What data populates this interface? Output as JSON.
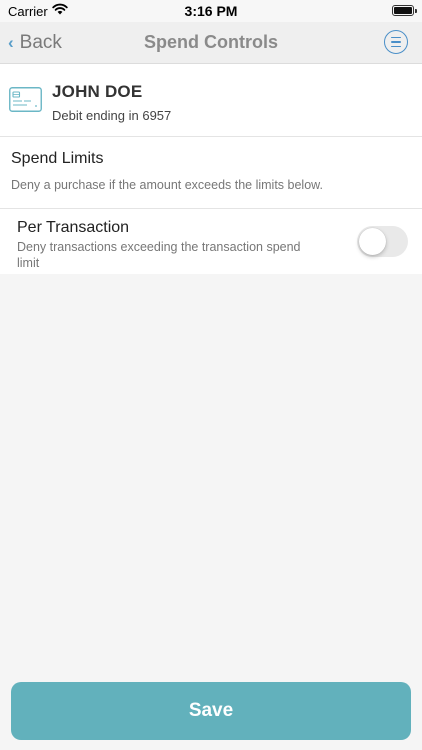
{
  "status_bar": {
    "carrier": "Carrier",
    "time": "3:16 PM",
    "wifi_icon": "wifi-icon",
    "battery_icon": "battery-full-icon"
  },
  "nav": {
    "back_label": "Back",
    "back_icon": "chevron-left-icon",
    "title": "Spend Controls",
    "menu_icon": "hamburger-circle-icon"
  },
  "card": {
    "icon": "credit-card-icon",
    "holder_name": "JOHN DOE",
    "subtitle": "Debit ending in 6957"
  },
  "spend_limits": {
    "title": "Spend Limits",
    "description": "Deny a purchase if the amount exceeds the limits below."
  },
  "per_transaction": {
    "title": "Per Transaction",
    "description": "Deny transactions exceeding the transaction spend limit",
    "enabled": false
  },
  "save_label": "Save",
  "colors": {
    "accent": "#62b1bc",
    "link": "#4a8fc8",
    "background": "#f5f5f5"
  }
}
